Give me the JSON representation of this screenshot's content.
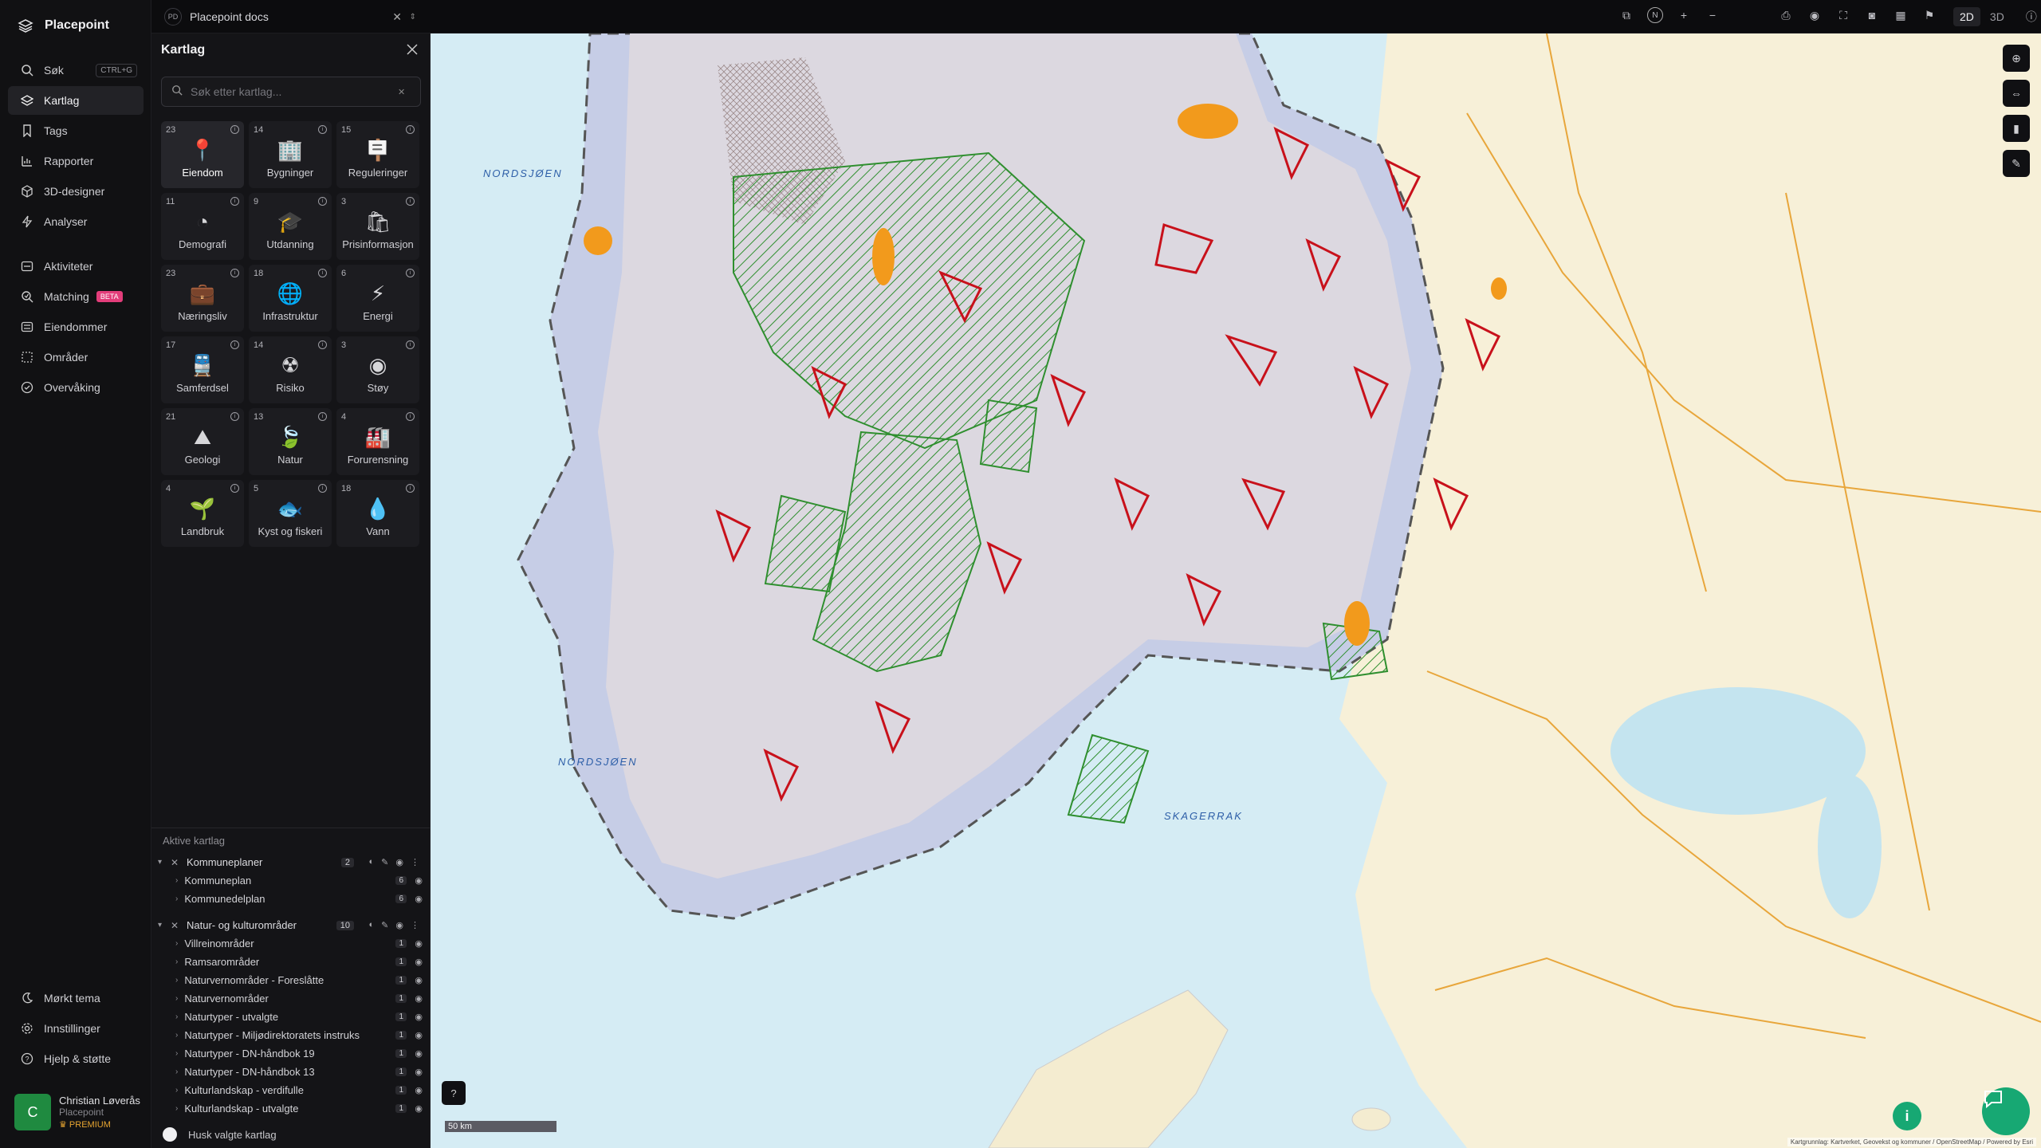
{
  "app": {
    "name": "Placepoint"
  },
  "nav": {
    "search": {
      "label": "Søk",
      "shortcut": "CTRL+G"
    },
    "primary": [
      {
        "key": "search",
        "label": "Søk",
        "icon": "search-icon"
      },
      {
        "key": "layers",
        "label": "Kartlag",
        "icon": "layers-icon"
      },
      {
        "key": "tags",
        "label": "Tags",
        "icon": "bookmark-icon"
      },
      {
        "key": "reports",
        "label": "Rapporter",
        "icon": "chart-icon"
      },
      {
        "key": "designer",
        "label": "3D-designer",
        "icon": "cube-icon"
      },
      {
        "key": "analyses",
        "label": "Analyser",
        "icon": "bolt-icon"
      }
    ],
    "secondary": [
      {
        "key": "activities",
        "label": "Aktiviteter",
        "icon": "activity-icon"
      },
      {
        "key": "matching",
        "label": "Matching",
        "icon": "matching-icon",
        "badge": "BETA"
      },
      {
        "key": "properties",
        "label": "Eiendommer",
        "icon": "list-icon"
      },
      {
        "key": "areas",
        "label": "Områder",
        "icon": "area-icon"
      },
      {
        "key": "monitoring",
        "label": "Overvåking",
        "icon": "monitor-icon"
      }
    ],
    "bottom": [
      {
        "key": "dark",
        "label": "Mørkt tema",
        "icon": "moon-icon"
      },
      {
        "key": "settings",
        "label": "Innstillinger",
        "icon": "gear-icon"
      },
      {
        "key": "help",
        "label": "Hjelp & støtte",
        "icon": "help-icon"
      }
    ]
  },
  "user": {
    "initial": "C",
    "name": "Christian Løverås",
    "org": "Placepoint",
    "plan": "PREMIUM"
  },
  "topbar": {
    "doc_badge": "PD",
    "doc_title": "Placepoint docs",
    "mode_2d": "2D",
    "mode_3d": "3D",
    "compass": "N"
  },
  "panel": {
    "title": "Kartlag",
    "search_placeholder": "Søk etter kartlag...",
    "categories": [
      {
        "count": "23",
        "label": "Eiendom",
        "glyph": "📍",
        "selected": true
      },
      {
        "count": "14",
        "label": "Bygninger",
        "glyph": "🏢"
      },
      {
        "count": "15",
        "label": "Reguleringer",
        "glyph": "🪧"
      },
      {
        "count": "11",
        "label": "Demografi",
        "glyph": "◔"
      },
      {
        "count": "9",
        "label": "Utdanning",
        "glyph": "🎓"
      },
      {
        "count": "3",
        "label": "Prisinformasjon",
        "glyph": "🛍"
      },
      {
        "count": "23",
        "label": "Næringsliv",
        "glyph": "💼"
      },
      {
        "count": "18",
        "label": "Infrastruktur",
        "glyph": "🌐"
      },
      {
        "count": "6",
        "label": "Energi",
        "glyph": "⚡"
      },
      {
        "count": "17",
        "label": "Samferdsel",
        "glyph": "🚆"
      },
      {
        "count": "14",
        "label": "Risiko",
        "glyph": "☢"
      },
      {
        "count": "3",
        "label": "Støy",
        "glyph": "◉"
      },
      {
        "count": "21",
        "label": "Geologi",
        "glyph": "⛰"
      },
      {
        "count": "13",
        "label": "Natur",
        "glyph": "🍃"
      },
      {
        "count": "4",
        "label": "Forurensning",
        "glyph": "🏭"
      },
      {
        "count": "4",
        "label": "Landbruk",
        "glyph": "🌱"
      },
      {
        "count": "5",
        "label": "Kyst og fiskeri",
        "glyph": "🐟"
      },
      {
        "count": "18",
        "label": "Vann",
        "glyph": "💧"
      }
    ],
    "active_title": "Aktive kartlag",
    "groups": [
      {
        "name": "Kommuneplaner",
        "count": "2",
        "items": [
          {
            "name": "Kommuneplan",
            "count": "6"
          },
          {
            "name": "Kommunedelplan",
            "count": "6"
          }
        ]
      },
      {
        "name": "Natur- og kulturområder",
        "count": "10",
        "items": [
          {
            "name": "Villreinområder",
            "count": "1"
          },
          {
            "name": "Ramsarområder",
            "count": "1"
          },
          {
            "name": "Naturvernområder - Foreslåtte",
            "count": "1"
          },
          {
            "name": "Naturvernområder",
            "count": "1"
          },
          {
            "name": "Naturtyper - utvalgte",
            "count": "1"
          },
          {
            "name": "Naturtyper - Miljødirektoratets instruks",
            "count": "1"
          },
          {
            "name": "Naturtyper - DN-håndbok 19",
            "count": "1"
          },
          {
            "name": "Naturtyper - DN-håndbok 13",
            "count": "1"
          },
          {
            "name": "Kulturlandskap - verdifulle",
            "count": "1"
          },
          {
            "name": "Kulturlandskap - utvalgte",
            "count": "1"
          }
        ]
      }
    ],
    "remember_label": "Husk valgte kartlag"
  },
  "map": {
    "labels": [
      {
        "text": "NORDSJØEN"
      },
      {
        "text": "NORDSJØEN"
      },
      {
        "text": "SKAGERRAK"
      }
    ],
    "scale": "50 km",
    "attribution": "Kartgrunnlag: Kartverket, Geovekst og kommuner / OpenStreetMap / Powered by Esri"
  },
  "colors": {
    "accent_green": "#17a873",
    "beta": "#e33d7a",
    "premium": "#e7a531"
  }
}
